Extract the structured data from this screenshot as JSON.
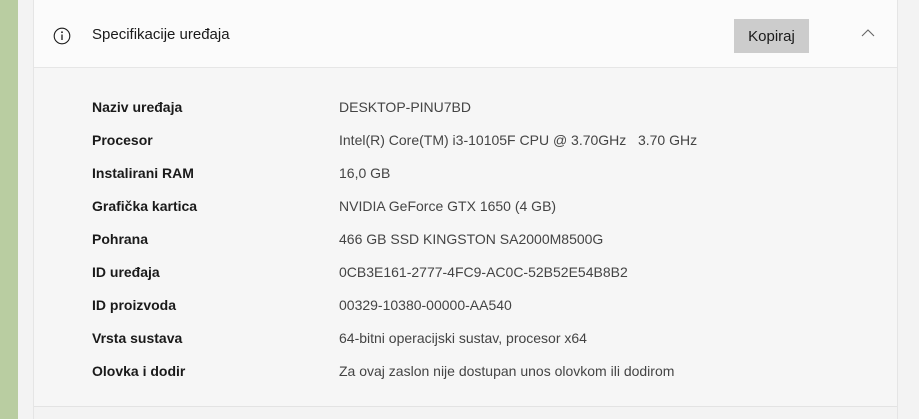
{
  "section": {
    "title": "Specifikacije uređaja",
    "copy_label": "Kopiraj",
    "info_icon": "info-icon",
    "collapse_icon": "chevron-up-icon"
  },
  "specs": [
    {
      "label": "Naziv uređaja",
      "value": "DESKTOP-PINU7BD"
    },
    {
      "label": "Procesor",
      "value": "Intel(R) Core(TM) i3-10105F CPU @ 3.70GHz   3.70 GHz"
    },
    {
      "label": "Instalirani RAM",
      "value": "16,0 GB"
    },
    {
      "label": "Grafička kartica",
      "value": "NVIDIA GeForce GTX 1650 (4 GB)"
    },
    {
      "label": "Pohrana",
      "value": "466 GB SSD KINGSTON SA2000M8500G"
    },
    {
      "label": "ID uređaja",
      "value": "0CB3E161-2777-4FC9-AC0C-52B52E54B8B2"
    },
    {
      "label": "ID proizvoda",
      "value": "00329-10380-00000-AA540"
    },
    {
      "label": "Vrsta sustava",
      "value": "64-bitni operacijski sustav, procesor x64"
    },
    {
      "label": "Olovka i dodir",
      "value": "Za ovaj zaslon nije dostupan unos olovkom ili dodirom"
    }
  ]
}
